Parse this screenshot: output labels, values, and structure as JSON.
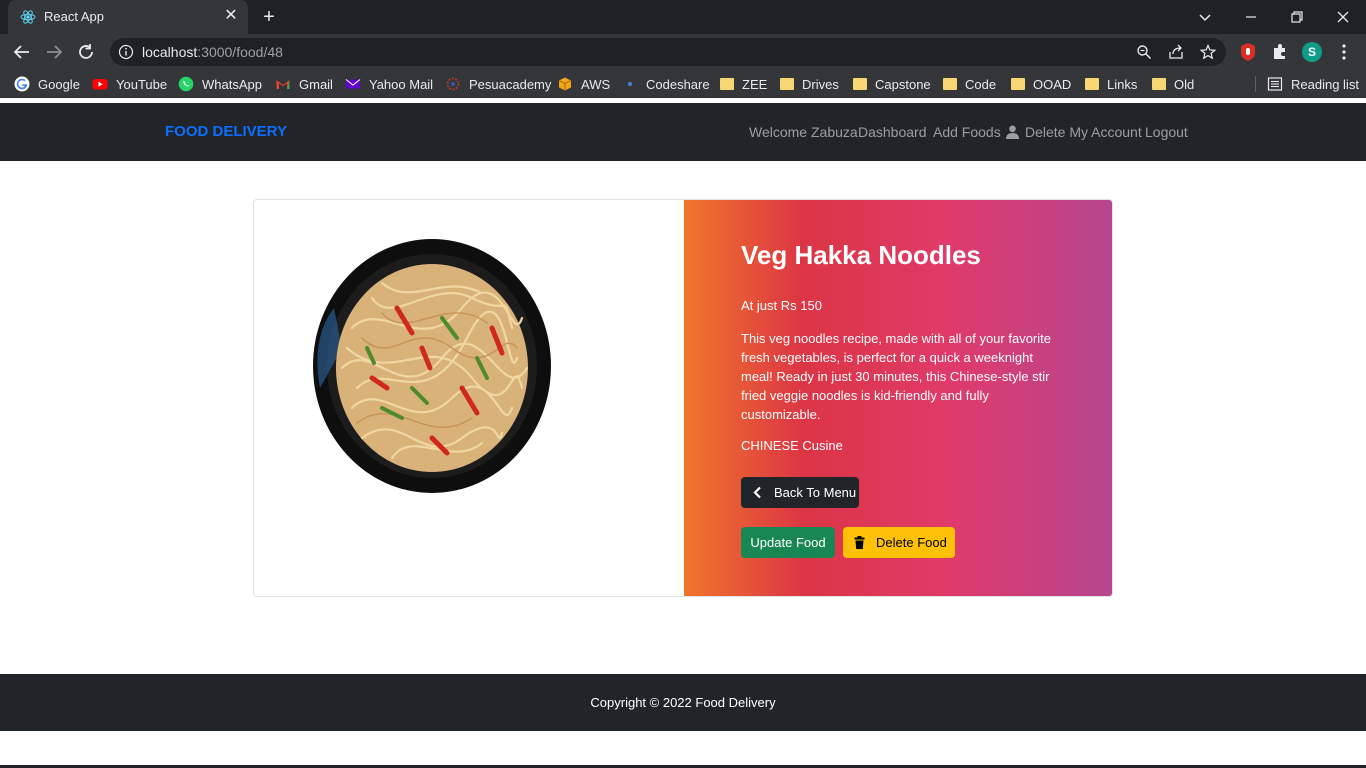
{
  "browser": {
    "tab_title": "React App",
    "url_host": "localhost",
    "url_path": ":3000/food/48",
    "profile_initial": "S",
    "bookmarks": [
      {
        "label": "Google",
        "icon": "google-icon"
      },
      {
        "label": "YouTube",
        "icon": "youtube-icon"
      },
      {
        "label": "WhatsApp",
        "icon": "whatsapp-icon"
      },
      {
        "label": "Gmail",
        "icon": "gmail-icon"
      },
      {
        "label": "Yahoo Mail",
        "icon": "yahoo-mail-icon"
      },
      {
        "label": "Pesuacademy",
        "icon": "pesuacademy-icon"
      },
      {
        "label": "AWS",
        "icon": "aws-icon"
      },
      {
        "label": "Codeshare",
        "icon": "codeshare-icon"
      },
      {
        "label": "ZEE",
        "icon": "folder-icon"
      },
      {
        "label": "Drives",
        "icon": "folder-icon"
      },
      {
        "label": "Capstone",
        "icon": "folder-icon"
      },
      {
        "label": "Code",
        "icon": "folder-icon"
      },
      {
        "label": "OOAD",
        "icon": "folder-icon"
      },
      {
        "label": "Links",
        "icon": "folder-icon"
      },
      {
        "label": "Old",
        "icon": "folder-icon"
      }
    ],
    "reading_list": "Reading list"
  },
  "nav": {
    "brand": "FOOD DELIVERY",
    "welcome": "Welcome Zabuza",
    "dashboard": "Dashboard",
    "add_foods": "Add Foods",
    "delete_account": "Delete My Account",
    "logout": "Logout"
  },
  "food": {
    "name": "Veg Hakka Noodles",
    "price": "At just Rs 150",
    "description": "This veg noodles recipe, made with all of your favorite fresh vegetables, is perfect for a quick a weeknight meal! Ready in just 30 minutes, this Chinese-style stir fried veggie noodles is kid-friendly and fully customizable.",
    "cuisine": "CHINESE Cusine",
    "back_button": "Back To Menu",
    "update_button": "Update Food",
    "delete_button": "Delete Food"
  },
  "footer": {
    "copyright": "Copyright © 2022 Food Delivery"
  },
  "colors": {
    "brand": "#0d6efd",
    "navbar": "#212529",
    "success": "#198754",
    "warning": "#ffc107",
    "gradient_start": "#f0762b",
    "gradient_end": "#b5468f"
  }
}
